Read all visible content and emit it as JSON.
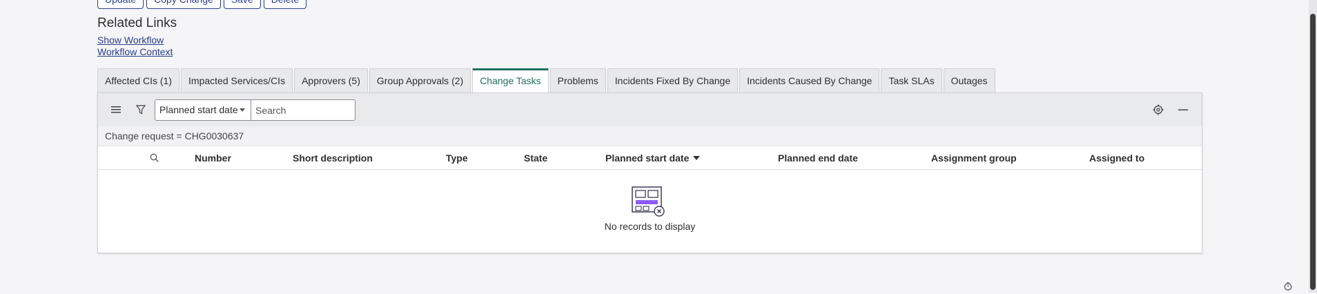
{
  "top_buttons": [
    "Update",
    "Copy Change",
    "Save",
    "Delete"
  ],
  "related_links": {
    "title": "Related Links",
    "show_workflow": "Show Workflow",
    "workflow_context": "Workflow Context"
  },
  "tabs": [
    {
      "label": "Affected CIs (1)"
    },
    {
      "label": "Impacted Services/CIs"
    },
    {
      "label": "Approvers (5)"
    },
    {
      "label": "Group Approvals (2)"
    },
    {
      "label": "Change Tasks"
    },
    {
      "label": "Problems"
    },
    {
      "label": "Incidents Fixed By Change"
    },
    {
      "label": "Incidents Caused By Change"
    },
    {
      "label": "Task SLAs"
    },
    {
      "label": "Outages"
    }
  ],
  "active_tab": "Change Tasks",
  "list": {
    "filter_field": "Planned start date",
    "search_placeholder": "Search",
    "breadcrumb": "Change request = CHG0030637",
    "columns": [
      "Number",
      "Short description",
      "Type",
      "State",
      "Planned start date",
      "Planned end date",
      "Assignment group",
      "Assigned to"
    ],
    "sorted_column": "Planned start date",
    "empty_message": "No records to display"
  },
  "colors": {
    "accent": "#1f6f5c",
    "link": "#293e8a",
    "empty_icon_purple": "#8b5cf6"
  }
}
